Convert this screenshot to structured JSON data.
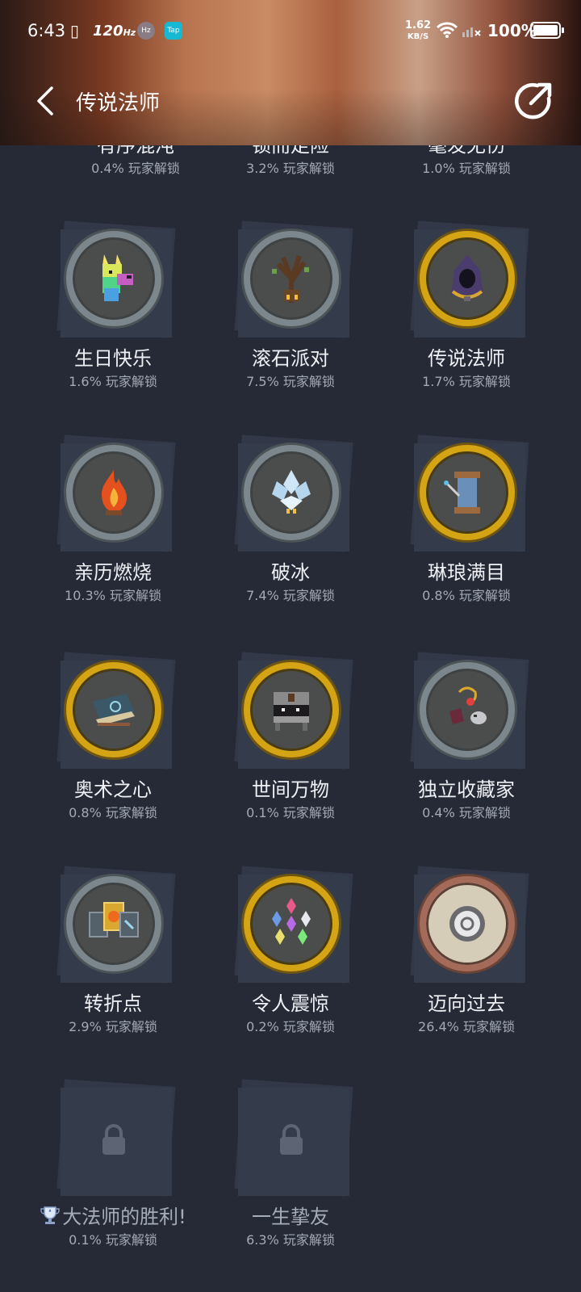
{
  "status_bar": {
    "time": "6:43",
    "refresh_rate": "120",
    "refresh_unit": "Hz",
    "hz_badge": "Hz",
    "tap_badge": "Tap",
    "net_speed_value": "1.62",
    "net_speed_unit": "KB/S",
    "battery": "100%"
  },
  "header": {
    "title": "传说法师"
  },
  "top_row": [
    {
      "name": "有序混沌",
      "pct": "0.4% 玩家解锁"
    },
    {
      "name": "锁而走险",
      "pct": "3.2% 玩家解锁"
    },
    {
      "name": "毫发无伤",
      "pct": "1.0% 玩家解锁"
    }
  ],
  "achievements": [
    {
      "name": "生日快乐",
      "pct": "1.6% 玩家解锁",
      "ring": "grey",
      "icon": "birthday-llama-icon"
    },
    {
      "name": "滚石派对",
      "pct": "7.5% 玩家解锁",
      "ring": "grey",
      "icon": "stone-tree-icon"
    },
    {
      "name": "传说法师",
      "pct": "1.7% 玩家解锁",
      "ring": "gold",
      "icon": "hooded-wizard-icon"
    },
    {
      "name": "亲历燃烧",
      "pct": "10.3% 玩家解锁",
      "ring": "grey",
      "icon": "fire-icon"
    },
    {
      "name": "破冰",
      "pct": "7.4% 玩家解锁",
      "ring": "grey",
      "icon": "ice-crystal-icon"
    },
    {
      "name": "琳琅满目",
      "pct": "0.8% 玩家解锁",
      "ring": "gold",
      "icon": "spool-icon"
    },
    {
      "name": "奥术之心",
      "pct": "0.8% 玩家解锁",
      "ring": "gold",
      "icon": "spellbook-icon"
    },
    {
      "name": "世间万物",
      "pct": "0.1% 玩家解锁",
      "ring": "gold",
      "icon": "treasure-chest-icon"
    },
    {
      "name": "独立收藏家",
      "pct": "0.4% 玩家解锁",
      "ring": "grey",
      "icon": "relics-icon"
    },
    {
      "name": "转折点",
      "pct": "2.9% 玩家解锁",
      "ring": "grey",
      "icon": "cards-icon"
    },
    {
      "name": "令人震惊",
      "pct": "0.2% 玩家解锁",
      "ring": "gold",
      "icon": "gems-icon"
    },
    {
      "name": "迈向过去",
      "pct": "26.4% 玩家解锁",
      "ring": "bronze",
      "icon": "portal-icon"
    },
    {
      "name": "大法师的胜利!",
      "pct": "0.1% 玩家解锁",
      "ring": "locked",
      "icon": "lock-icon"
    },
    {
      "name": "一生挚友",
      "pct": "6.3% 玩家解锁",
      "ring": "locked",
      "icon": "lock-icon"
    }
  ],
  "colors": {
    "background": "#252a36",
    "gold_ring": "#d4a414",
    "grey_ring": "#7c878d",
    "bronze_ring": "#a46b5a"
  }
}
